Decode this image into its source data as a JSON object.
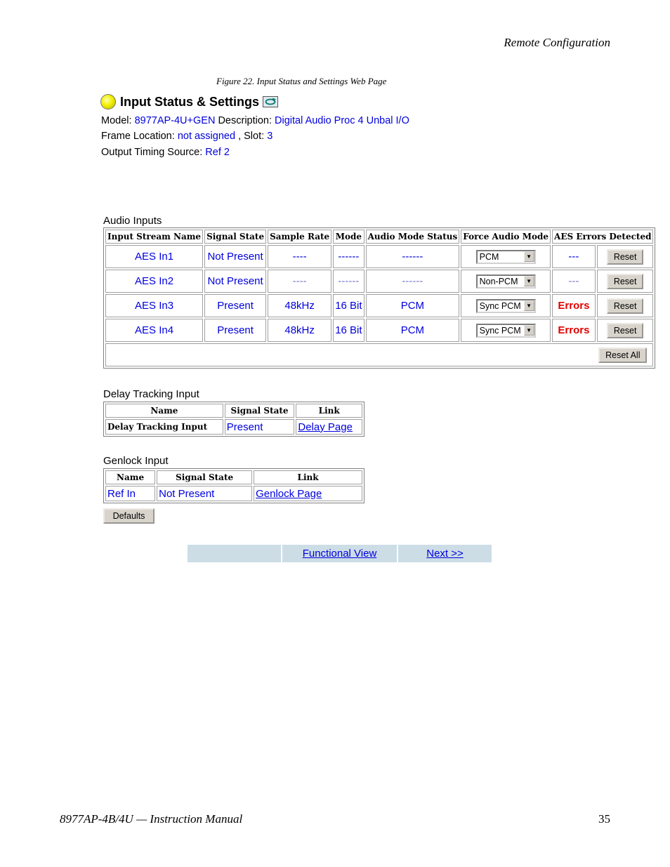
{
  "document": {
    "running_header": "Remote Configuration",
    "figure_caption": "Figure 22.  Input Status and Settings Web Page",
    "footer_left": "8977AP-4B/4U — Instruction Manual",
    "page_number": "35"
  },
  "page": {
    "title": "Input Status & Settings",
    "model_label": "Model:",
    "model_value": "8977AP-4U+GEN",
    "description_label": "Description:",
    "description_value": "Digital Audio Proc 4 Unbal I/O",
    "frame_location_label": "Frame Location:",
    "frame_location_value": "not assigned",
    "slot_label": ", Slot:",
    "slot_value": "3",
    "output_timing_label": "Output Timing Source:",
    "output_timing_value": "Ref 2"
  },
  "audio_inputs": {
    "title": "Audio Inputs",
    "headers": [
      "Input Stream Name",
      "Signal State",
      "Sample Rate",
      "Mode",
      "Audio Mode Status",
      "Force Audio Mode",
      "AES Errors Detected"
    ],
    "rows": [
      {
        "name": "AES In1",
        "signal": "Not Present",
        "rate": "----",
        "mode": "------",
        "status": "------",
        "force": "PCM",
        "errors": "---",
        "reset": "Reset"
      },
      {
        "name": "AES In2",
        "signal": "Not Present",
        "rate": "----",
        "mode": "------",
        "status": "------",
        "force": "Non-PCM",
        "errors": "---",
        "reset": "Reset"
      },
      {
        "name": "AES In3",
        "signal": "Present",
        "rate": "48kHz",
        "mode": "16 Bit",
        "status": "PCM",
        "force": "Sync PCM",
        "errors": "Errors",
        "reset": "Reset"
      },
      {
        "name": "AES In4",
        "signal": "Present",
        "rate": "48kHz",
        "mode": "16 Bit",
        "status": "PCM",
        "force": "Sync PCM",
        "errors": "Errors",
        "reset": "Reset"
      }
    ],
    "reset_all": "Reset All"
  },
  "delay_tracking": {
    "title": "Delay Tracking Input",
    "headers": [
      "Name",
      "Signal State",
      "Link"
    ],
    "row": {
      "name": "Delay Tracking Input",
      "signal": "Present",
      "link": "Delay Page"
    }
  },
  "genlock": {
    "title": "Genlock Input",
    "headers": [
      "Name",
      "Signal State",
      "Link"
    ],
    "row": {
      "name": "Ref In",
      "signal": "Not Present",
      "link": "Genlock Page"
    }
  },
  "defaults_button": "Defaults",
  "nav": {
    "functional_view": "Functional View",
    "next": "Next >>"
  },
  "icons": {
    "status": "yellow-bulb-icon",
    "refresh": "refresh-icon",
    "dropdown": "chevron-down-icon"
  },
  "colors": {
    "link_blue": "#0000dd",
    "error_red": "#e00000",
    "nav_bg": "#ccdde6"
  }
}
